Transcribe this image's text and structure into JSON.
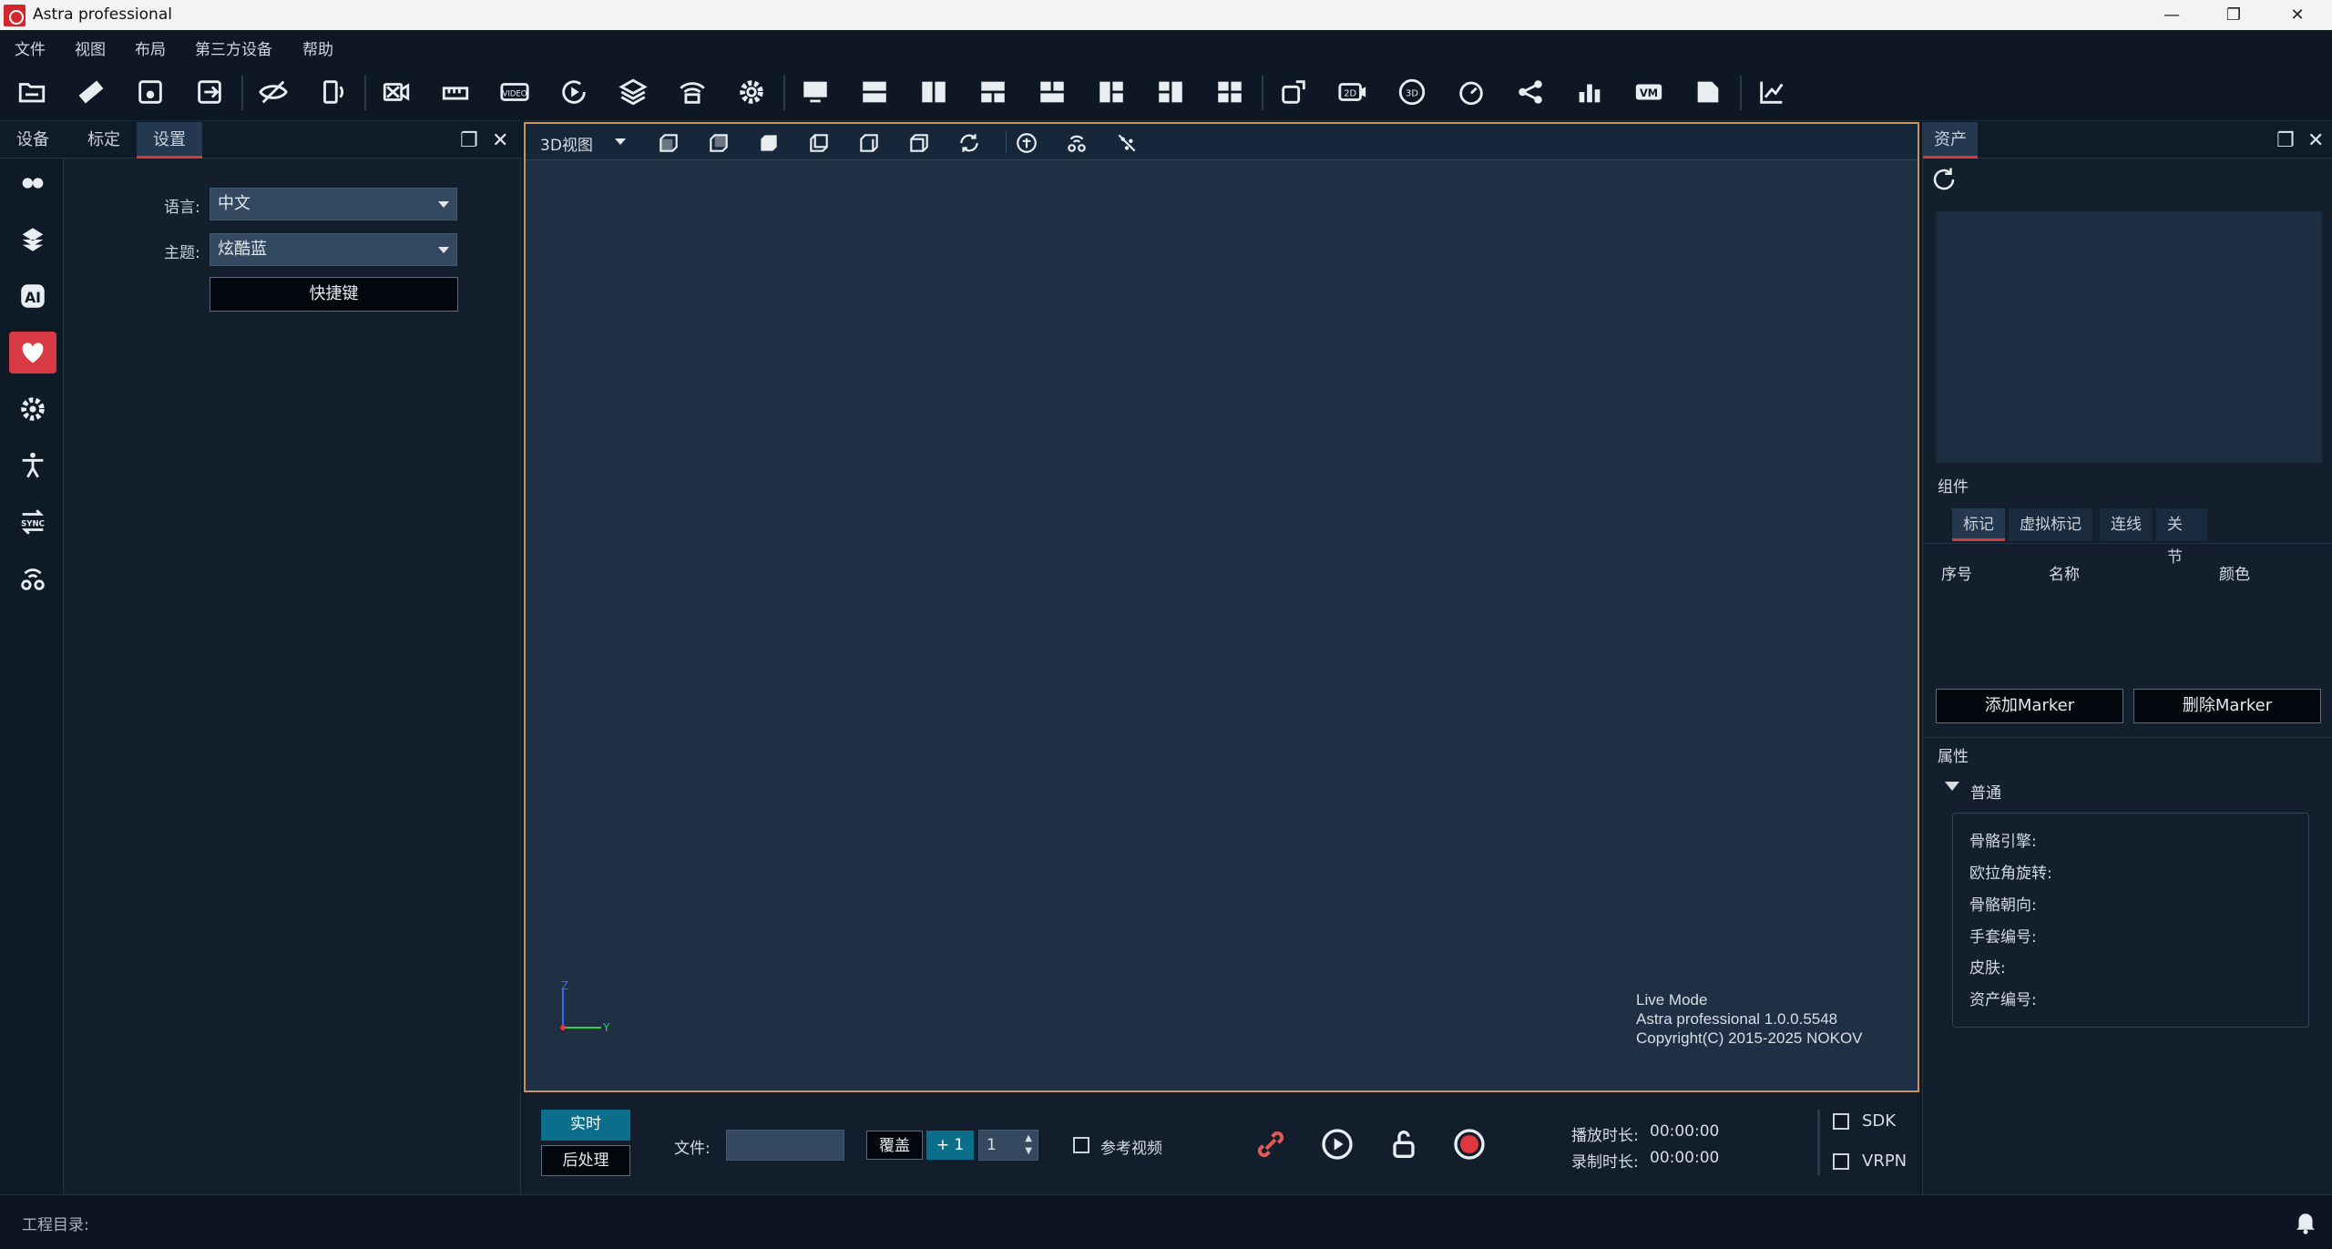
{
  "window": {
    "title": "Astra professional",
    "minimize": "—",
    "restore": "❐",
    "close": "✕"
  },
  "menu": [
    "文件",
    "视图",
    "布局",
    "第三方设备",
    "帮助"
  ],
  "toolbar_icons": [
    "open-folder-icon",
    "ruler-icon",
    "save-icon",
    "save-as-icon",
    "hide-icon",
    "rotate-device-icon",
    "camera-off-icon",
    "measure-icon",
    "video-icon",
    "replay-icon",
    "layers-icon",
    "wifi-device-icon",
    "settings-icon",
    "monitor-icon",
    "layout-2-row-icon",
    "layout-2-col-icon",
    "layout-3-icon",
    "layout-3b-icon",
    "layout-3c-icon",
    "layout-3d-icon",
    "layout-4-icon",
    "screenshot-icon",
    "2d-view-icon",
    "3d-view-icon",
    "speed-icon",
    "share-icon",
    "bar-chart-icon",
    "vm-icon",
    "export-icon",
    "graph-icon"
  ],
  "left_panel": {
    "tabs": [
      "设备",
      "标定",
      "设置"
    ],
    "active_tab": "设置",
    "language_label": "语言:",
    "language_value": "中文",
    "theme_label": "主题:",
    "theme_value": "炫酷蓝",
    "shortcut_button": "快捷键",
    "side_icons": [
      "camera-pair-icon",
      "calibration-icon",
      "ai-icon",
      "heart-icon",
      "gear-icon",
      "skeleton-icon",
      "sync-icon",
      "wireless-icon"
    ]
  },
  "viewport": {
    "view_selector": "3D视图",
    "view_icons": [
      "front-view-icon",
      "back-view-icon",
      "left-view-icon",
      "right-view-icon",
      "top-view-icon",
      "bottom-view-icon",
      "reset-view-icon",
      "skeleton-toggle-icon",
      "marker-toggle-icon",
      "points-toggle-icon"
    ],
    "axis_x": "Y",
    "axis_z": "Z",
    "mode_text": "Live Mode",
    "version_text": "Astra professional 1.0.0.5548",
    "copyright_text": "Copyright(C) 2015-2025 NOKOV"
  },
  "bottom": {
    "live_button": "实时",
    "post_button": "后处理",
    "file_label": "文件:",
    "file_value": "",
    "overwrite_button": "覆盖",
    "plus_button": "+ 1",
    "spin_value": "1",
    "ref_video_label": "参考视频",
    "play_duration_label": "播放时长:",
    "play_duration_value": "00:00:00",
    "record_duration_label": "录制时长:",
    "record_duration_value": "00:00:00",
    "sdk_label": "SDK",
    "vrpn_label": "VRPN"
  },
  "right_panel": {
    "tab": "资产",
    "components_label": "组件",
    "component_tabs": [
      "标记",
      "虚拟标记",
      "连线",
      "关节"
    ],
    "columns": [
      "序号",
      "名称",
      "颜色"
    ],
    "add_button": "添加Marker",
    "delete_button": "删除Marker",
    "properties_label": "属性",
    "group_label": "普通",
    "properties": [
      "骨骼引擎:",
      "欧拉角旋转:",
      "骨骼朝向:",
      "手套编号:",
      "皮肤:",
      "资产编号:"
    ]
  },
  "status": {
    "project_dir_label": "工程目录:"
  },
  "colors": {
    "accent_red": "#d73a45",
    "accent_teal": "#0b6f8c",
    "frame_orange": "#c9935b"
  }
}
